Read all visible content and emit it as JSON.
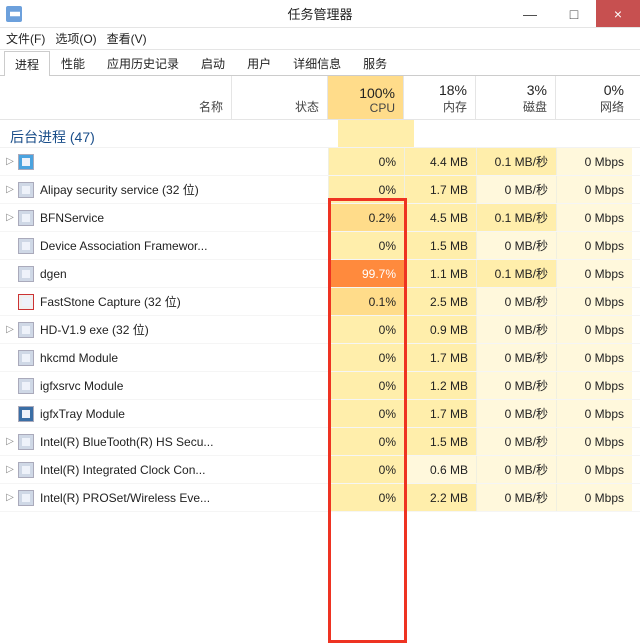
{
  "window": {
    "title": "任务管理器",
    "min_symbol": "—",
    "max_symbol": "□",
    "close_symbol": "×"
  },
  "menu": {
    "file": "文件(F)",
    "options": "选项(O)",
    "view": "查看(V)"
  },
  "tabs": [
    "进程",
    "性能",
    "应用历史记录",
    "启动",
    "用户",
    "详细信息",
    "服务"
  ],
  "active_tab": 0,
  "columns": {
    "name": "名称",
    "status": "状态",
    "cpu": {
      "pct": "100%",
      "label": "CPU"
    },
    "mem": {
      "pct": "18%",
      "label": "内存"
    },
    "disk": {
      "pct": "3%",
      "label": "磁盘"
    },
    "net": {
      "pct": "0%",
      "label": "网络"
    }
  },
  "section": {
    "label": "后台进程 (47)"
  },
  "processes": [
    {
      "name": "",
      "icon": "gear",
      "expand": true,
      "cpu": "0%",
      "mem": "4.4 MB",
      "disk": "0.1 MB/秒",
      "net": "0 Mbps",
      "cpu_heat": 1,
      "mem_heat": 1,
      "disk_heat": 1,
      "net_heat": 0
    },
    {
      "name": "Alipay security service (32 位)",
      "icon": "app",
      "expand": true,
      "cpu": "0%",
      "mem": "1.7 MB",
      "disk": "0 MB/秒",
      "net": "0 Mbps",
      "cpu_heat": 1,
      "mem_heat": 1,
      "disk_heat": 0,
      "net_heat": 0
    },
    {
      "name": "BFNService",
      "icon": "app",
      "expand": true,
      "cpu": "0.2%",
      "mem": "4.5 MB",
      "disk": "0.1 MB/秒",
      "net": "0 Mbps",
      "cpu_heat": 2,
      "mem_heat": 1,
      "disk_heat": 1,
      "net_heat": 0
    },
    {
      "name": "Device Association Framewor...",
      "icon": "app",
      "expand": false,
      "cpu": "0%",
      "mem": "1.5 MB",
      "disk": "0 MB/秒",
      "net": "0 Mbps",
      "cpu_heat": 1,
      "mem_heat": 1,
      "disk_heat": 0,
      "net_heat": 0
    },
    {
      "name": "dgen",
      "icon": "app",
      "expand": false,
      "cpu": "99.7%",
      "mem": "1.1 MB",
      "disk": "0.1 MB/秒",
      "net": "0 Mbps",
      "cpu_heat": 9,
      "mem_heat": 1,
      "disk_heat": 1,
      "net_heat": 0
    },
    {
      "name": "FastStone Capture (32 位)",
      "icon": "fsc",
      "expand": false,
      "cpu": "0.1%",
      "mem": "2.5 MB",
      "disk": "0 MB/秒",
      "net": "0 Mbps",
      "cpu_heat": 2,
      "mem_heat": 1,
      "disk_heat": 0,
      "net_heat": 0
    },
    {
      "name": "HD-V1.9 exe (32 位)",
      "icon": "app",
      "expand": true,
      "cpu": "0%",
      "mem": "0.9 MB",
      "disk": "0 MB/秒",
      "net": "0 Mbps",
      "cpu_heat": 1,
      "mem_heat": 1,
      "disk_heat": 0,
      "net_heat": 0
    },
    {
      "name": "hkcmd Module",
      "icon": "app",
      "expand": false,
      "cpu": "0%",
      "mem": "1.7 MB",
      "disk": "0 MB/秒",
      "net": "0 Mbps",
      "cpu_heat": 1,
      "mem_heat": 1,
      "disk_heat": 0,
      "net_heat": 0
    },
    {
      "name": "igfxsrvc Module",
      "icon": "app",
      "expand": false,
      "cpu": "0%",
      "mem": "1.2 MB",
      "disk": "0 MB/秒",
      "net": "0 Mbps",
      "cpu_heat": 1,
      "mem_heat": 1,
      "disk_heat": 0,
      "net_heat": 0
    },
    {
      "name": "igfxTray Module",
      "icon": "tray",
      "expand": false,
      "cpu": "0%",
      "mem": "1.7 MB",
      "disk": "0 MB/秒",
      "net": "0 Mbps",
      "cpu_heat": 1,
      "mem_heat": 1,
      "disk_heat": 0,
      "net_heat": 0
    },
    {
      "name": "Intel(R) BlueTooth(R) HS Secu...",
      "icon": "app",
      "expand": true,
      "cpu": "0%",
      "mem": "1.5 MB",
      "disk": "0 MB/秒",
      "net": "0 Mbps",
      "cpu_heat": 1,
      "mem_heat": 1,
      "disk_heat": 0,
      "net_heat": 0
    },
    {
      "name": "Intel(R) Integrated Clock Con...",
      "icon": "app",
      "expand": true,
      "cpu": "0%",
      "mem": "0.6 MB",
      "disk": "0 MB/秒",
      "net": "0 Mbps",
      "cpu_heat": 1,
      "mem_heat": 0,
      "disk_heat": 0,
      "net_heat": 0
    },
    {
      "name": "Intel(R) PROSet/Wireless Eve...",
      "icon": "app",
      "expand": true,
      "cpu": "0%",
      "mem": "2.2 MB",
      "disk": "0 MB/秒",
      "net": "0 Mbps",
      "cpu_heat": 1,
      "mem_heat": 1,
      "disk_heat": 0,
      "net_heat": 0
    }
  ],
  "heat_classes": {
    "0": "hm-0",
    "1": "hm-1",
    "2": "hm-2",
    "3": "hm-3",
    "9": "hm-hot"
  }
}
